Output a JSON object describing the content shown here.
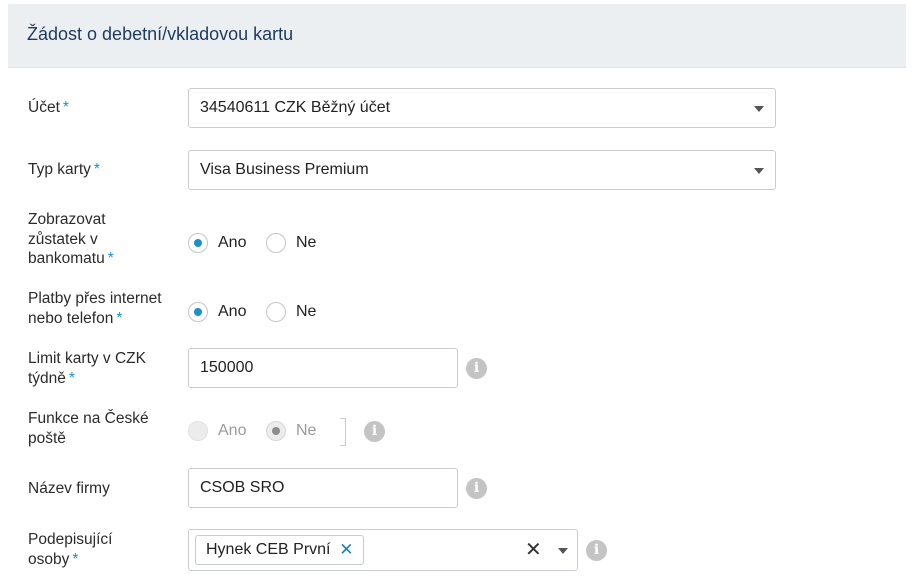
{
  "form": {
    "title": "Žádost o debetní/vkladovou kartu",
    "required_mark": "*",
    "info_glyph": "i",
    "account": {
      "label": "Účet",
      "value": "34540611 CZK Běžný účet"
    },
    "card_type": {
      "label": "Typ karty",
      "value": "Visa Business Premium"
    },
    "show_balance": {
      "label_lines": [
        "Zobrazovat",
        "zůstatek v",
        "bankomatu"
      ],
      "options": [
        "Ano",
        "Ne"
      ],
      "selected": "Ano"
    },
    "internet_payments": {
      "label_lines": [
        "Platby přes internet",
        "nebo telefon"
      ],
      "options": [
        "Ano",
        "Ne"
      ],
      "selected": "Ano"
    },
    "card_limit": {
      "label_lines": [
        "Limit karty v CZK",
        "týdně"
      ],
      "value": "150000"
    },
    "post_office": {
      "label_lines": [
        "Funkce na České",
        "poště"
      ],
      "options": [
        "Ano",
        "Ne"
      ],
      "selected": "Ne",
      "disabled": true
    },
    "company_name": {
      "label": "Název firmy",
      "value": "CSOB SRO"
    },
    "signers": {
      "label_lines": [
        "Podepisující",
        "osoby"
      ],
      "tags": [
        "Hynek CEB První"
      ],
      "tag_remove_glyph": "✕",
      "clear_glyph": "✕"
    }
  },
  "colors": {
    "accent": "#1a91c9",
    "header_bg": "#eceff1",
    "title": "#1d3a5f"
  },
  "icons": [
    "chevron-down-icon",
    "info-icon",
    "close-icon"
  ]
}
